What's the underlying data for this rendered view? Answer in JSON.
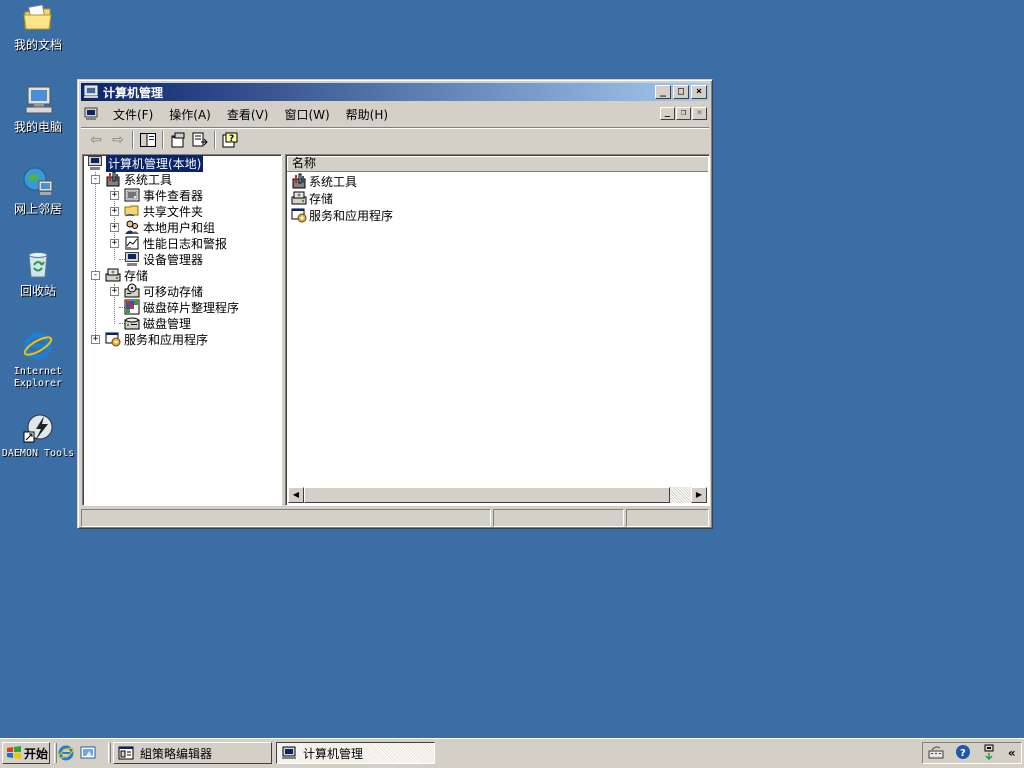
{
  "desktop": {
    "icons": [
      {
        "label": "我的文档",
        "icon": "my-documents-icon"
      },
      {
        "label": "我的电脑",
        "icon": "my-computer-icon"
      },
      {
        "label": "网上邻居",
        "icon": "network-places-icon"
      },
      {
        "label": "回收站",
        "icon": "recycle-bin-icon"
      },
      {
        "label": "Internet Explorer",
        "icon": "internet-explorer-icon"
      },
      {
        "label": "DAEMON Tools",
        "icon": "daemon-tools-icon"
      }
    ]
  },
  "window": {
    "title": "计算机管理",
    "menu": [
      "文件(F)",
      "操作(A)",
      "查看(V)",
      "窗口(W)",
      "帮助(H)"
    ],
    "tree": [
      {
        "label": "计算机管理(本地)",
        "level": 0,
        "expander": "",
        "selected": true
      },
      {
        "label": "系统工具",
        "level": 1,
        "expander": "-"
      },
      {
        "label": "事件查看器",
        "level": 2,
        "expander": "+"
      },
      {
        "label": "共享文件夹",
        "level": 2,
        "expander": "+"
      },
      {
        "label": "本地用户和组",
        "level": 2,
        "expander": "+"
      },
      {
        "label": "性能日志和警报",
        "level": 2,
        "expander": "+"
      },
      {
        "label": "设备管理器",
        "level": 2,
        "expander": ""
      },
      {
        "label": "存储",
        "level": 1,
        "expander": "-"
      },
      {
        "label": "可移动存储",
        "level": 2,
        "expander": "+"
      },
      {
        "label": "磁盘碎片整理程序",
        "level": 2,
        "expander": ""
      },
      {
        "label": "磁盘管理",
        "level": 2,
        "expander": ""
      },
      {
        "label": "服务和应用程序",
        "level": 1,
        "expander": "+"
      }
    ],
    "list_header": "名称",
    "list_items": [
      "系统工具",
      "存储",
      "服务和应用程序"
    ]
  },
  "taskbar": {
    "start_label": "开始",
    "tasks": [
      {
        "label": "組策略编辑器",
        "active": false
      },
      {
        "label": "计算机管理",
        "active": true
      }
    ]
  },
  "colors": {
    "desktop": "#3a6ea5",
    "title_active": "#0a246a",
    "face": "#d4d0c8"
  }
}
